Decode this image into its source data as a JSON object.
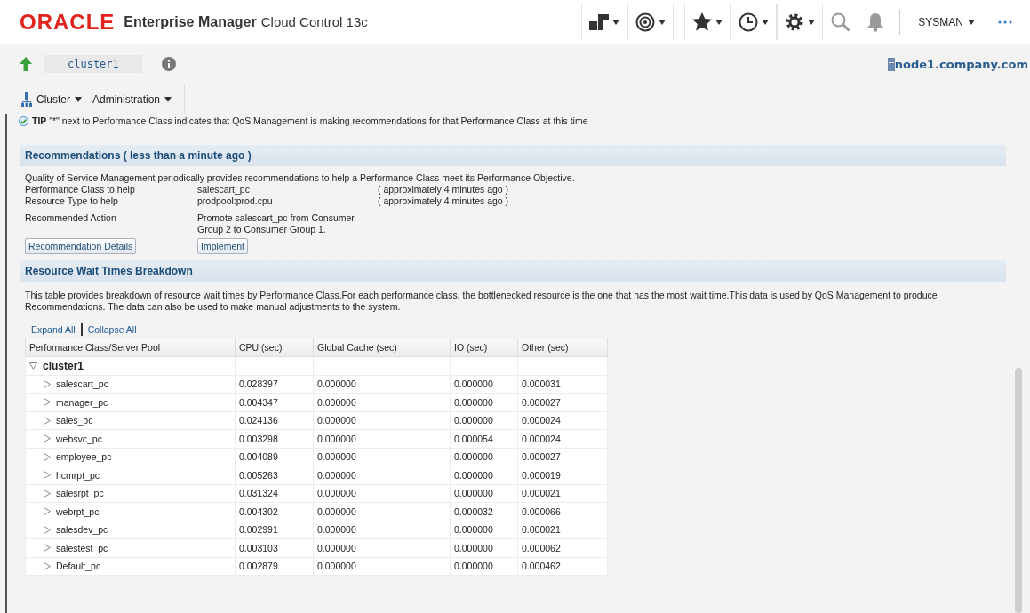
{
  "header": {
    "brand": "ORACLE",
    "product": "Enterprise Manager",
    "edition": "Cloud Control 13c",
    "user": "SYSMAN"
  },
  "target": {
    "name": "cluster1",
    "host": "node1.company.com"
  },
  "menus": [
    "Cluster",
    "Administration"
  ],
  "tip": "**TIP** \"*\" next to Performance Class indicates that QoS Management is making recommendations for that Performance Class at this time",
  "recommendations": {
    "title": "Recommendations ( less than a minute ago )",
    "intro": "Quality of Service Management periodically provides recommendations to help a Performance Class meet its Performance Objective.",
    "fields": [
      {
        "label": "Performance Class to help",
        "value": "salescart_pc",
        "note": "( approximately 4 minutes ago )"
      },
      {
        "label": "Resource Type to help",
        "value": "prodpool:prod.cpu",
        "note": "( approximately 4 minutes ago )"
      },
      {
        "label": "Recommended Action",
        "value": "Promote salescart_pc from Consumer Group 2 to Consumer Group 1."
      }
    ],
    "buttons": [
      "Recommendation Details",
      "Implement"
    ]
  },
  "breakdown": {
    "title": "Resource Wait Times Breakdown",
    "description": "This table provides breakdown of resource wait times by Performance Class.For each performance class, the bottlenecked resource is the one that has the most wait time.This data is used by QoS Management to produce Recommendations. The data can also be used to make manual adjustments to the system.",
    "links": [
      "Expand All",
      "Collapse All"
    ],
    "columns": [
      "Performance Class/Server Pool",
      "CPU (sec)",
      "Global Cache (sec)",
      "IO (sec)",
      "Other (sec)"
    ],
    "rows": [
      {
        "name": "cluster1",
        "expanded": true,
        "cells": [],
        "children": [
          {
            "name": "salescart_pc",
            "expanded": false,
            "cells": [
              "0.028397",
              "0.000000",
              "0.000000",
              "0.000031"
            ]
          },
          {
            "name": "manager_pc",
            "expanded": false,
            "cells": [
              "0.004347",
              "0.000000",
              "0.000000",
              "0.000027"
            ]
          },
          {
            "name": "sales_pc",
            "expanded": false,
            "cells": [
              "0.024136",
              "0.000000",
              "0.000000",
              "0.000024"
            ]
          },
          {
            "name": "websvc_pc",
            "expanded": false,
            "cells": [
              "0.003298",
              "0.000000",
              "0.000054",
              "0.000024"
            ]
          },
          {
            "name": "employee_pc",
            "expanded": false,
            "cells": [
              "0.004089",
              "0.000000",
              "0.000000",
              "0.000027"
            ]
          },
          {
            "name": "hcmrpt_pc",
            "expanded": false,
            "cells": [
              "0.005263",
              "0.000000",
              "0.000000",
              "0.000019"
            ]
          },
          {
            "name": "salesrpt_pc",
            "expanded": false,
            "cells": [
              "0.031324",
              "0.000000",
              "0.000000",
              "0.000021"
            ]
          },
          {
            "name": "webrpt_pc",
            "expanded": false,
            "cells": [
              "0.004302",
              "0.000000",
              "0.000032",
              "0.000066"
            ]
          },
          {
            "name": "salesdev_pc",
            "expanded": false,
            "cells": [
              "0.002991",
              "0.000000",
              "0.000000",
              "0.000021"
            ]
          },
          {
            "name": "salestest_pc",
            "expanded": false,
            "cells": [
              "0.003103",
              "0.000000",
              "0.000000",
              "0.000062"
            ]
          },
          {
            "name": "Default_pc",
            "expanded": false,
            "cells": [
              "0.002879",
              "0.000000",
              "0.000000",
              "0.000462"
            ]
          }
        ]
      }
    ]
  }
}
